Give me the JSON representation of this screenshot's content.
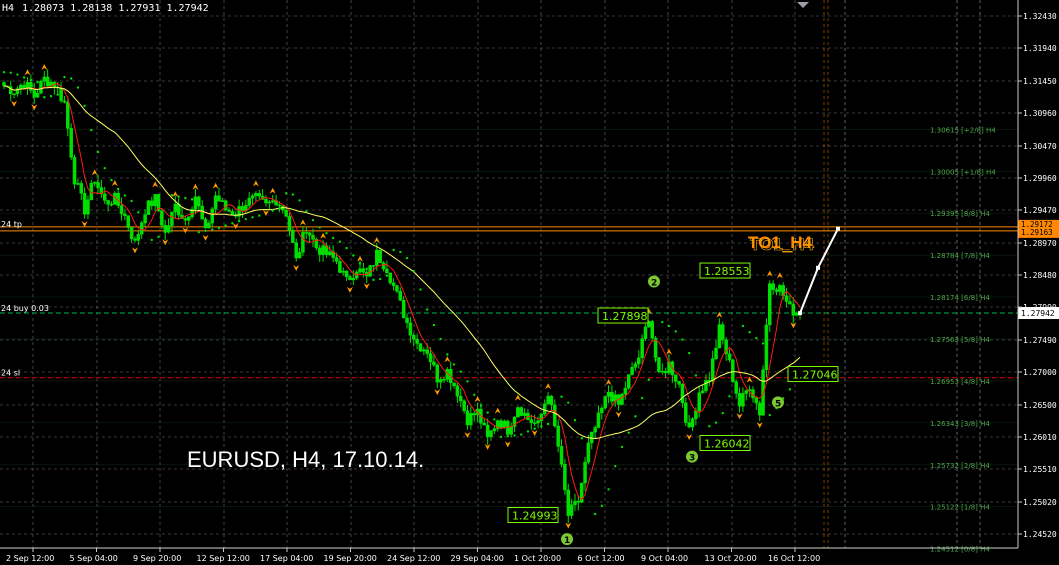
{
  "header": {
    "symbol_prefix": "H4",
    "ohlc": "1.28073 1.28138 1.27931 1.27942"
  },
  "overlay_title": "EURUSD, H4, 17.10.14.",
  "indicator_label": "TO1_H4",
  "colors": {
    "background": "#000000",
    "grid": "#c8c8c8",
    "bull": "#00e000",
    "bear": "#e00000",
    "ma_red": "#ff1a1a",
    "ma_yellow": "#ffff66",
    "psar": "#00e000",
    "fractal": "#ff9900",
    "label_green": "#7cfc00",
    "orange": "#ff8800",
    "forecast": "#ffffff"
  },
  "chart_data": {
    "type": "candlestick",
    "symbol": "EURUSD",
    "timeframe": "H4",
    "date": "17.10.14.",
    "ylim": [
      1.2452,
      1.325
    ],
    "grid": true,
    "x_ticks": [
      "2 Sep 12:00",
      "5 Sep 04:00",
      "9 Sep 20:00",
      "12 Sep 12:00",
      "17 Sep 04:00",
      "19 Sep 20:00",
      "24 Sep 12:00",
      "29 Sep 04:00",
      "1 Oct 20:00",
      "6 Oct 12:00",
      "9 Oct 04:00",
      "13 Oct 20:00",
      "16 Oct 12:00"
    ],
    "y_ticks": [
      "1.32430",
      "1.31940",
      "1.31450",
      "1.30960",
      "1.30470",
      "1.29960",
      "1.29470",
      "1.28970",
      "1.28480",
      "1.27990",
      "1.27490",
      "1.27000",
      "1.26500",
      "1.26010",
      "1.25510",
      "1.25020",
      "1.24520"
    ],
    "current_price": "1.27942",
    "stacked_price_labels": [
      "1.29172",
      "1.29163"
    ],
    "close_path": [
      1.3125,
      1.3118,
      1.313,
      1.311,
      1.3135,
      1.3128,
      1.31,
      1.299,
      1.2945,
      1.299,
      1.2955,
      1.296,
      1.2935,
      1.2895,
      1.2945,
      1.296,
      1.291,
      1.295,
      1.293,
      1.2965,
      1.291,
      1.2965,
      1.2945,
      1.294,
      1.2955,
      1.296,
      1.295,
      1.296,
      1.294,
      1.287,
      1.292,
      1.289,
      1.288,
      1.287,
      1.284,
      1.286,
      1.2845,
      1.288,
      1.286,
      1.282,
      1.278,
      1.275,
      1.274,
      1.27,
      1.271,
      1.268,
      1.264,
      1.265,
      1.261,
      1.264,
      1.2625,
      1.266,
      1.264,
      1.263,
      1.268,
      1.26,
      1.25,
      1.252,
      1.26,
      1.264,
      1.268,
      1.266,
      1.27,
      1.273,
      1.279,
      1.27,
      1.272,
      1.269,
      1.262,
      1.268,
      1.27,
      1.277,
      1.272,
      1.266,
      1.269,
      1.265,
      1.284,
      1.283,
      1.28,
      1.2794
    ],
    "levels": [
      {
        "label": "1.30615 [+2/8] H4",
        "value": 1.30615
      },
      {
        "label": "1.30005 [+1/8] H4",
        "value": 1.30005
      },
      {
        "label": "1.29395 [8/8] H4",
        "value": 1.29395
      },
      {
        "label": "1.28784 [7/8] H4",
        "value": 1.28784
      },
      {
        "label": "1.28174 [6/8] H4",
        "value": 1.28174
      },
      {
        "label": "1.27563 [5/8] H4",
        "value": 1.27563
      },
      {
        "label": "1.26953 [4/8] H4",
        "value": 1.26953
      },
      {
        "label": "1.26343 [3/8] H4",
        "value": 1.26343
      },
      {
        "label": "1.25732 [2/8] H4",
        "value": 1.25732
      },
      {
        "label": "1.25122 [1/8] H4",
        "value": 1.25122
      },
      {
        "label": "1.24512 [0/8] H4",
        "value": 1.24512
      }
    ],
    "order_lines": [
      {
        "label": "24 tp",
        "value": 1.29167,
        "style": "solid",
        "color": "#ff8800"
      },
      {
        "label": "24 buy 0.03",
        "value": 1.27942,
        "style": "dash",
        "color": "#00b050"
      },
      {
        "label": "24 sl",
        "value": 1.27,
        "style": "dash",
        "color": "#e00000"
      }
    ],
    "price_labels": [
      {
        "text": "1.28553",
        "value": 1.28553
      },
      {
        "text": "1.27898",
        "value": 1.27898
      },
      {
        "text": "1.27046",
        "value": 1.27046
      },
      {
        "text": "1.26042",
        "value": 1.26042
      },
      {
        "text": "1.24993",
        "value": 1.24993
      }
    ],
    "waves": [
      {
        "label": "1",
        "value": 1.2465
      },
      {
        "label": "2",
        "value": 1.284
      },
      {
        "label": "3",
        "value": 1.2585
      },
      {
        "label": "5",
        "value": 1.2664
      }
    ]
  }
}
